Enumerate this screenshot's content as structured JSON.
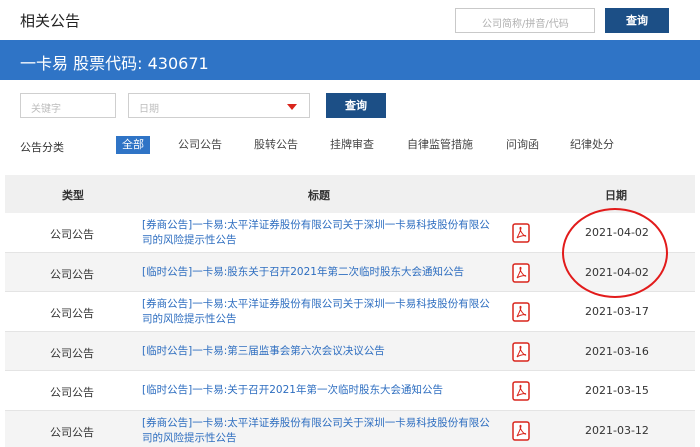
{
  "header": {
    "title": "相关公告",
    "search_placeholder": "公司简称/拼音/代码",
    "search_button": "查询"
  },
  "banner": {
    "company": "一卡易",
    "code_label": "股票代码:",
    "code": "430671"
  },
  "filters": {
    "keyword_placeholder": "关键字",
    "date_placeholder": "日期",
    "query_button": "查询"
  },
  "categories": {
    "label": "公告分类",
    "items": [
      "全部",
      "公司公告",
      "股转公告",
      "挂牌审查",
      "自律监管措施",
      "问询函",
      "纪律处分"
    ]
  },
  "table": {
    "headers": {
      "type": "类型",
      "title": "标题",
      "date": "日期"
    },
    "rows": [
      {
        "type": "公司公告",
        "title": "[券商公告]一卡易:太平洋证券股份有限公司关于深圳一卡易科技股份有限公司的风险提示性公告",
        "date": "2021-04-02"
      },
      {
        "type": "公司公告",
        "title": "[临时公告]一卡易:股东关于召开2021年第二次临时股东大会通知公告",
        "date": "2021-04-02"
      },
      {
        "type": "公司公告",
        "title": "[券商公告]一卡易:太平洋证券股份有限公司关于深圳一卡易科技股份有限公司的风险提示性公告",
        "date": "2021-03-17"
      },
      {
        "type": "公司公告",
        "title": "[临时公告]一卡易:第三届监事会第六次会议决议公告",
        "date": "2021-03-16"
      },
      {
        "type": "公司公告",
        "title": "[临时公告]一卡易:关于召开2021年第一次临时股东大会通知公告",
        "date": "2021-03-15"
      },
      {
        "type": "公司公告",
        "title": "[券商公告]一卡易:太平洋证券股份有限公司关于深圳一卡易科技股份有限公司的风险提示性公告",
        "date": "2021-03-12"
      }
    ]
  },
  "colors": {
    "brand_blue": "#2f74c6",
    "dark_button": "#1c4f86",
    "link": "#2e6ec0",
    "annotation_red": "#e21b1b"
  }
}
